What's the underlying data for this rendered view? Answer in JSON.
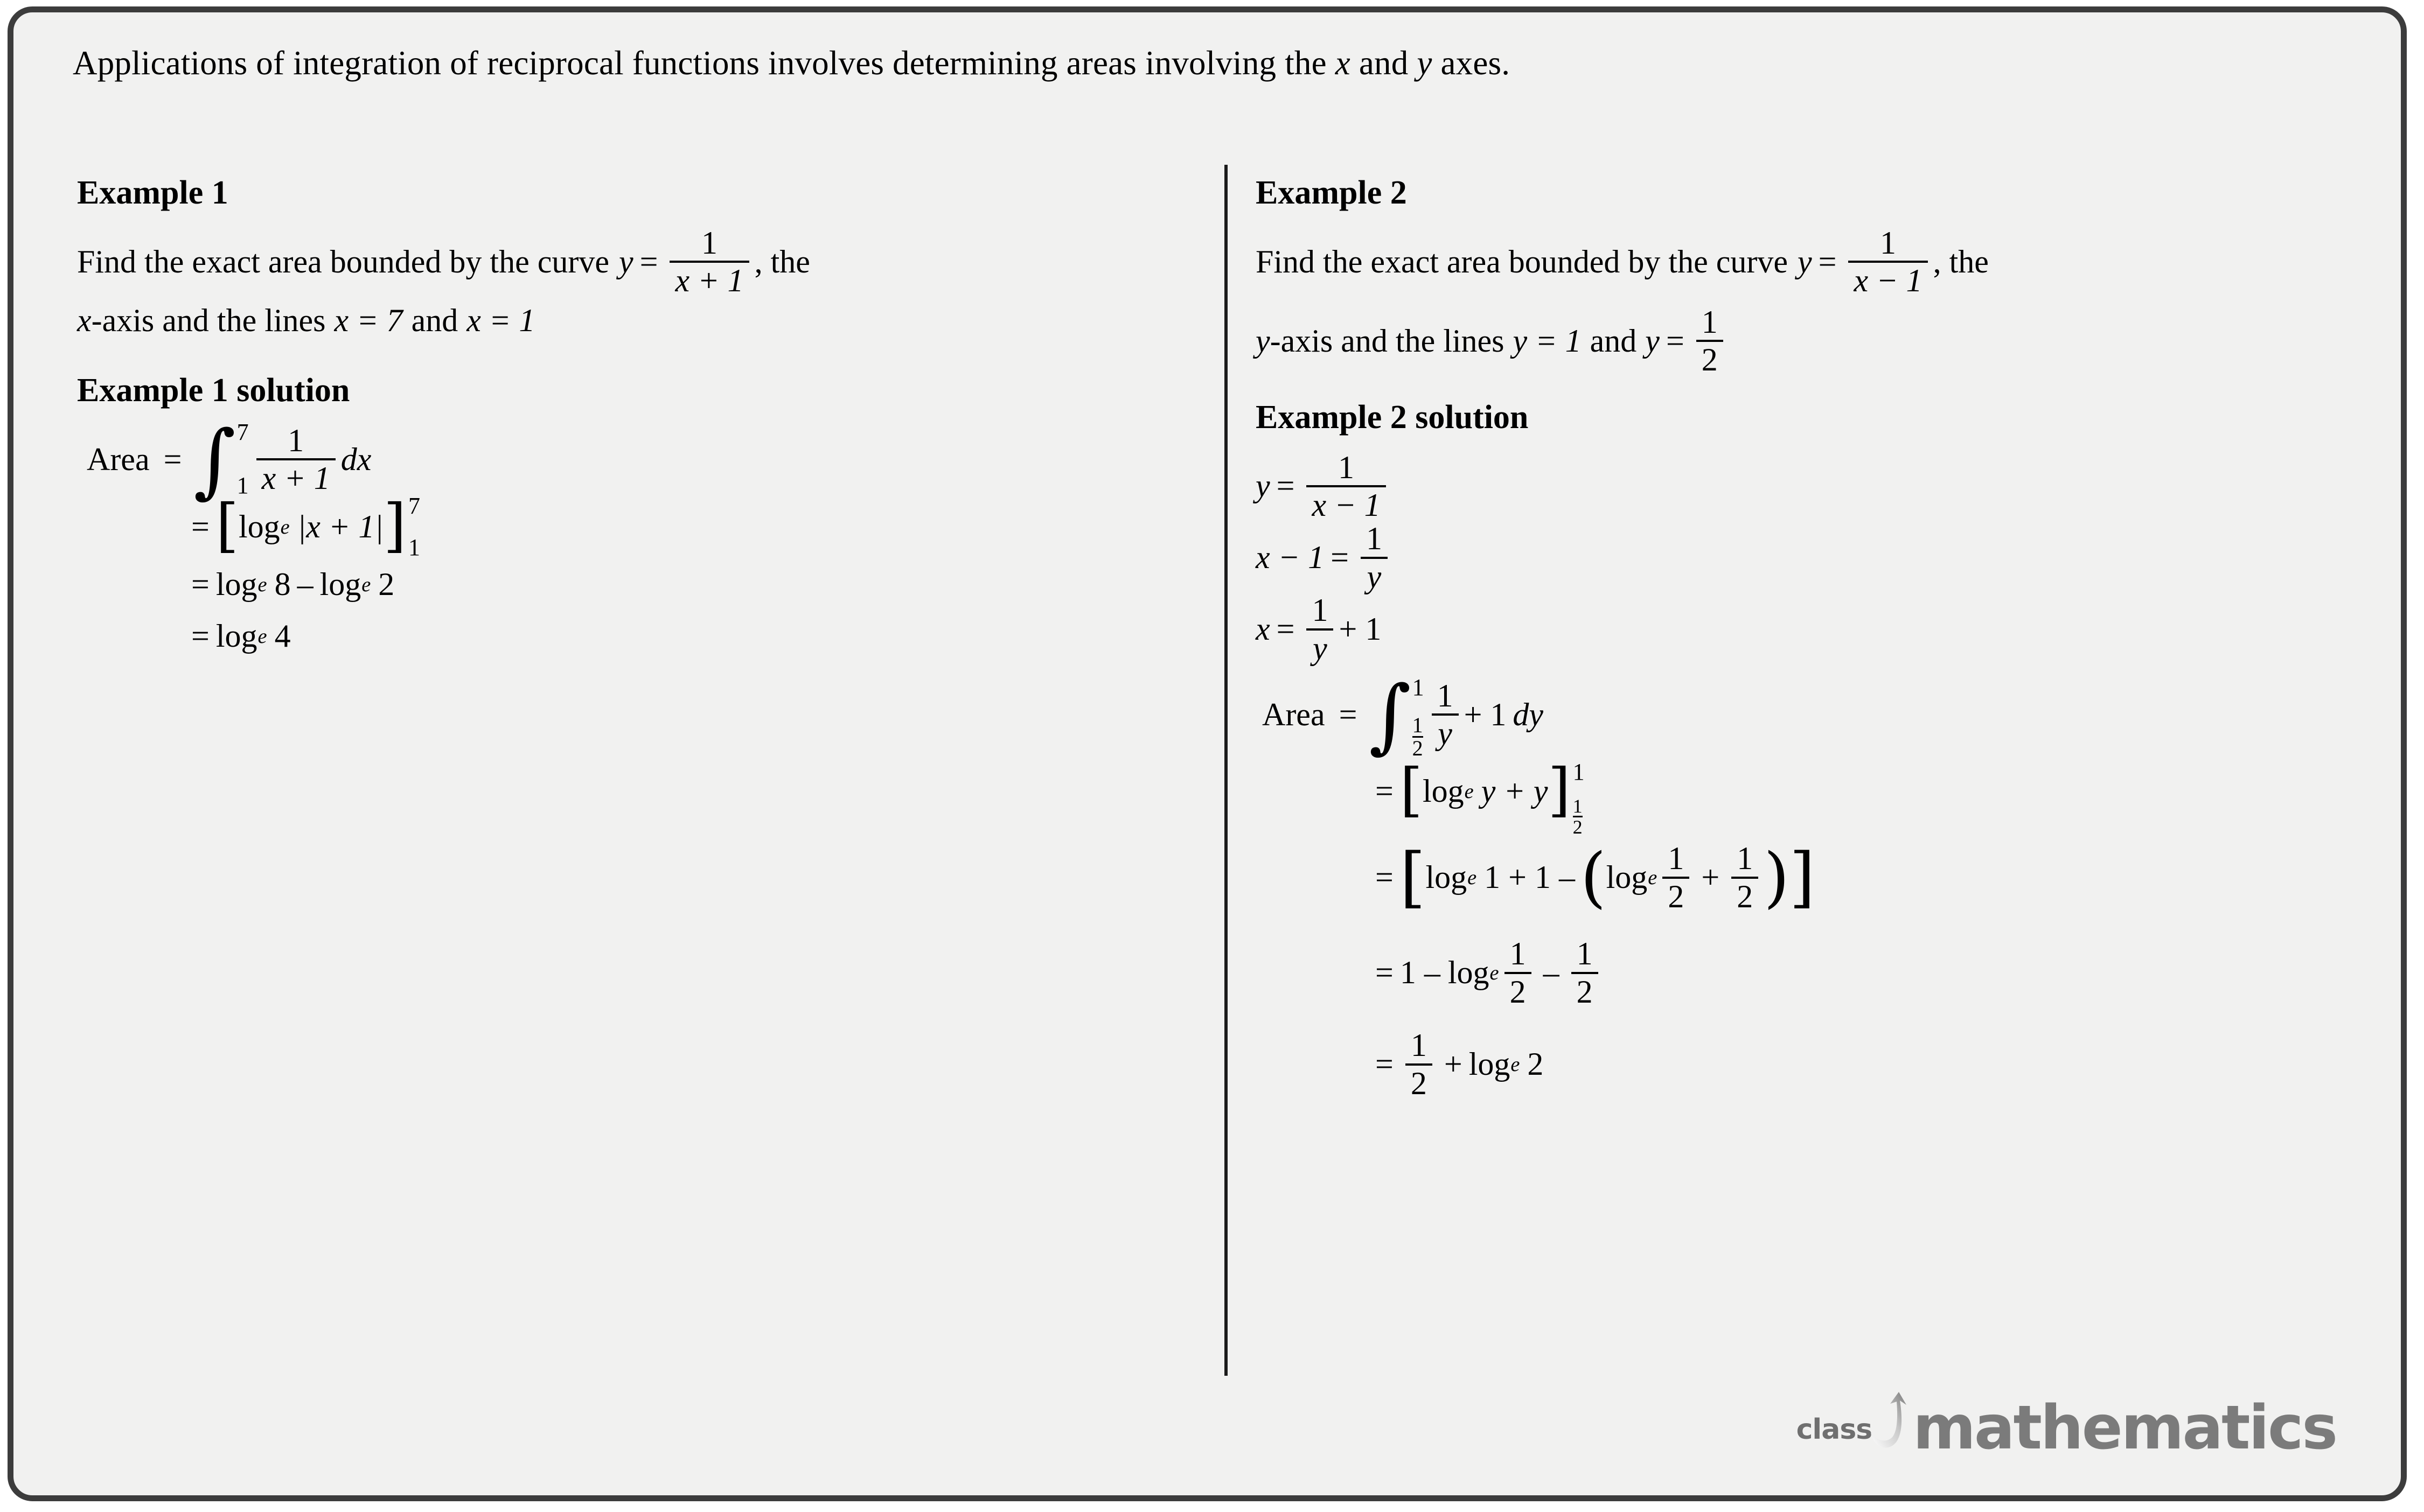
{
  "document": {
    "intro": "Applications of integration of reciprocal functions involves determining areas involving the x and y axes."
  },
  "example1": {
    "heading": "Example 1",
    "question": {
      "part1": "Find the exact area bounded by the curve",
      "y_var": "y",
      "equals": "=",
      "frac_num": "1",
      "frac_den": "x + 1",
      "comma_the": ", the",
      "part2_pre": "x",
      "part2": "-axis and the lines",
      "line_x1": "x = 7",
      "and": "and",
      "line_x2": "x = 1"
    },
    "solution": {
      "heading": "Example 1 solution",
      "area_label": "Area",
      "equals": "=",
      "integral_upper": "7",
      "integral_lower": "1",
      "integrand_num": "1",
      "integrand_den": "x + 1",
      "differential": "dx",
      "step2_open": "[",
      "step2_log": "log",
      "step2_sub": "e",
      "step2_arg": "|x + 1|",
      "step2_close": "]",
      "step2_upper": "7",
      "step2_lower": "1",
      "step3": "log",
      "step3_sub": "e",
      "step3_a": "8",
      "step3_op": "–",
      "step3_log2": "log",
      "step3_sub2": "e",
      "step3_b": "2",
      "step4_log": "log",
      "step4_sub": "e",
      "step4_arg": "4"
    }
  },
  "example2": {
    "heading": "Example 2",
    "question": {
      "part1": "Find the exact area bounded by the curve",
      "y_var": "y",
      "equals": "=",
      "frac_num": "1",
      "frac_den": "x − 1",
      "comma_the": ", the",
      "part2_pre": "y",
      "part2": "-axis and the lines",
      "line_y1": "y = 1",
      "and": "and",
      "line_y2_var": "y",
      "line_y2_eq": "=",
      "line_y2_num": "1",
      "line_y2_den": "2"
    },
    "solution": {
      "heading": "Example 2 solution",
      "l1_lhs": "y",
      "l1_eq": "=",
      "l1_num": "1",
      "l1_den": "x − 1",
      "l2_lhs": "x − 1",
      "l2_eq": "=",
      "l2_num": "1",
      "l2_den": "y",
      "l3_lhs": "x",
      "l3_eq": "=",
      "l3_num": "1",
      "l3_den": "y",
      "l3_tail": "+ 1",
      "area_label": "Area",
      "area_eq": "=",
      "integral_upper": "1",
      "integral_lower_num": "1",
      "integral_lower_den": "2",
      "integrand_num": "1",
      "integrand_den": "y",
      "integrand_tail": "+ 1",
      "differential": "dy",
      "s2_open": "[",
      "s2_log": "log",
      "s2_sub": "e",
      "s2_arg": "y + y",
      "s2_close": "]",
      "s2_upper": "1",
      "s2_lower_num": "1",
      "s2_lower_den": "2",
      "s3_open": "[",
      "s3_log": "log",
      "s3_sub": "e",
      "s3_a": "1 + 1 –",
      "s3_paren_open": "(",
      "s3_log2": "log",
      "s3_sub2": "e",
      "s3_f1_num": "1",
      "s3_f1_den": "2",
      "s3_plus": "+",
      "s3_f2_num": "1",
      "s3_f2_den": "2",
      "s3_paren_close": ")",
      "s3_close": "]",
      "s4_lead": "1 –",
      "s4_log": "log",
      "s4_sub": "e",
      "s4_f1_num": "1",
      "s4_f1_den": "2",
      "s4_minus": "–",
      "s4_f2_num": "1",
      "s4_f2_den": "2",
      "s5_f_num": "1",
      "s5_f_den": "2",
      "s5_plus": "+",
      "s5_log": "log",
      "s5_sub": "e",
      "s5_arg": "2",
      "eq_sign": "="
    }
  },
  "logo": {
    "class_word": "class",
    "math_word": "mathematics",
    "color": "#7b7b7b"
  }
}
